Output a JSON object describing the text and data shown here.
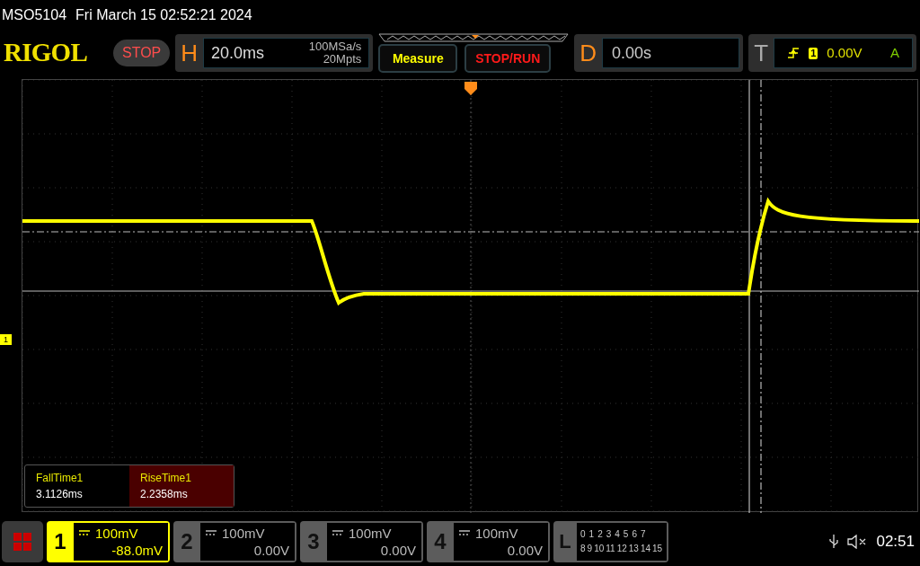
{
  "status_line": {
    "model": "MSO5104",
    "datetime": "Fri March 15 02:52:21 2024"
  },
  "brand": "RIGOL",
  "run_state": "STOP",
  "horizontal": {
    "label": "H",
    "timebase": "20.0ms",
    "sample_rate": "100MSa/s",
    "memory_depth": "20Mpts"
  },
  "buttons": [
    {
      "label": "Measure",
      "kind": "measure"
    },
    {
      "label": "STOP/RUN",
      "kind": "run"
    }
  ],
  "delay": {
    "label": "D",
    "value": "0.00s"
  },
  "trigger": {
    "label": "T",
    "source": "1",
    "level": "0.00V",
    "mode": "A"
  },
  "channel_marker": "1",
  "measurements": [
    {
      "name": "FallTime1",
      "value": "3.1126ms",
      "selected": false
    },
    {
      "name": "RiseTime1",
      "value": "2.2358ms",
      "selected": true
    }
  ],
  "channels": [
    {
      "number": "1",
      "scale": "100mV",
      "offset": "-88.0mV",
      "active": true
    },
    {
      "number": "2",
      "scale": "100mV",
      "offset": "0.00V",
      "active": false
    },
    {
      "number": "3",
      "scale": "100mV",
      "offset": "0.00V",
      "active": false
    },
    {
      "number": "4",
      "scale": "100mV",
      "offset": "0.00V",
      "active": false
    }
  ],
  "logic": {
    "label": "L",
    "bits_row_1": [
      "0",
      "1",
      "2",
      "3",
      "4",
      "5",
      "6",
      "7"
    ],
    "bits_row_2": [
      "8",
      "9",
      "10",
      "11",
      "12",
      "13",
      "14",
      "15"
    ]
  },
  "clock": "02:51"
}
